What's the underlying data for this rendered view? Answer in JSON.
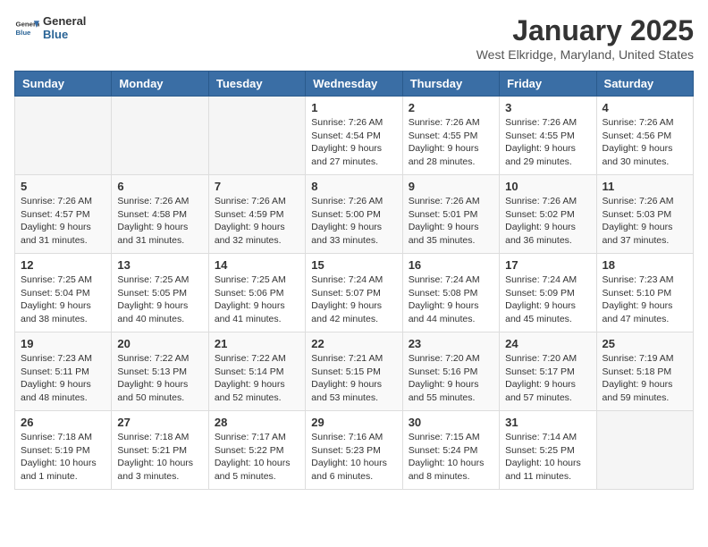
{
  "header": {
    "logo_general": "General",
    "logo_blue": "Blue",
    "month_title": "January 2025",
    "location": "West Elkridge, Maryland, United States"
  },
  "weekdays": [
    "Sunday",
    "Monday",
    "Tuesday",
    "Wednesday",
    "Thursday",
    "Friday",
    "Saturday"
  ],
  "weeks": [
    [
      {
        "day": "",
        "info": ""
      },
      {
        "day": "",
        "info": ""
      },
      {
        "day": "",
        "info": ""
      },
      {
        "day": "1",
        "info": "Sunrise: 7:26 AM\nSunset: 4:54 PM\nDaylight: 9 hours and 27 minutes."
      },
      {
        "day": "2",
        "info": "Sunrise: 7:26 AM\nSunset: 4:55 PM\nDaylight: 9 hours and 28 minutes."
      },
      {
        "day": "3",
        "info": "Sunrise: 7:26 AM\nSunset: 4:55 PM\nDaylight: 9 hours and 29 minutes."
      },
      {
        "day": "4",
        "info": "Sunrise: 7:26 AM\nSunset: 4:56 PM\nDaylight: 9 hours and 30 minutes."
      }
    ],
    [
      {
        "day": "5",
        "info": "Sunrise: 7:26 AM\nSunset: 4:57 PM\nDaylight: 9 hours and 31 minutes."
      },
      {
        "day": "6",
        "info": "Sunrise: 7:26 AM\nSunset: 4:58 PM\nDaylight: 9 hours and 31 minutes."
      },
      {
        "day": "7",
        "info": "Sunrise: 7:26 AM\nSunset: 4:59 PM\nDaylight: 9 hours and 32 minutes."
      },
      {
        "day": "8",
        "info": "Sunrise: 7:26 AM\nSunset: 5:00 PM\nDaylight: 9 hours and 33 minutes."
      },
      {
        "day": "9",
        "info": "Sunrise: 7:26 AM\nSunset: 5:01 PM\nDaylight: 9 hours and 35 minutes."
      },
      {
        "day": "10",
        "info": "Sunrise: 7:26 AM\nSunset: 5:02 PM\nDaylight: 9 hours and 36 minutes."
      },
      {
        "day": "11",
        "info": "Sunrise: 7:26 AM\nSunset: 5:03 PM\nDaylight: 9 hours and 37 minutes."
      }
    ],
    [
      {
        "day": "12",
        "info": "Sunrise: 7:25 AM\nSunset: 5:04 PM\nDaylight: 9 hours and 38 minutes."
      },
      {
        "day": "13",
        "info": "Sunrise: 7:25 AM\nSunset: 5:05 PM\nDaylight: 9 hours and 40 minutes."
      },
      {
        "day": "14",
        "info": "Sunrise: 7:25 AM\nSunset: 5:06 PM\nDaylight: 9 hours and 41 minutes."
      },
      {
        "day": "15",
        "info": "Sunrise: 7:24 AM\nSunset: 5:07 PM\nDaylight: 9 hours and 42 minutes."
      },
      {
        "day": "16",
        "info": "Sunrise: 7:24 AM\nSunset: 5:08 PM\nDaylight: 9 hours and 44 minutes."
      },
      {
        "day": "17",
        "info": "Sunrise: 7:24 AM\nSunset: 5:09 PM\nDaylight: 9 hours and 45 minutes."
      },
      {
        "day": "18",
        "info": "Sunrise: 7:23 AM\nSunset: 5:10 PM\nDaylight: 9 hours and 47 minutes."
      }
    ],
    [
      {
        "day": "19",
        "info": "Sunrise: 7:23 AM\nSunset: 5:11 PM\nDaylight: 9 hours and 48 minutes."
      },
      {
        "day": "20",
        "info": "Sunrise: 7:22 AM\nSunset: 5:13 PM\nDaylight: 9 hours and 50 minutes."
      },
      {
        "day": "21",
        "info": "Sunrise: 7:22 AM\nSunset: 5:14 PM\nDaylight: 9 hours and 52 minutes."
      },
      {
        "day": "22",
        "info": "Sunrise: 7:21 AM\nSunset: 5:15 PM\nDaylight: 9 hours and 53 minutes."
      },
      {
        "day": "23",
        "info": "Sunrise: 7:20 AM\nSunset: 5:16 PM\nDaylight: 9 hours and 55 minutes."
      },
      {
        "day": "24",
        "info": "Sunrise: 7:20 AM\nSunset: 5:17 PM\nDaylight: 9 hours and 57 minutes."
      },
      {
        "day": "25",
        "info": "Sunrise: 7:19 AM\nSunset: 5:18 PM\nDaylight: 9 hours and 59 minutes."
      }
    ],
    [
      {
        "day": "26",
        "info": "Sunrise: 7:18 AM\nSunset: 5:19 PM\nDaylight: 10 hours and 1 minute."
      },
      {
        "day": "27",
        "info": "Sunrise: 7:18 AM\nSunset: 5:21 PM\nDaylight: 10 hours and 3 minutes."
      },
      {
        "day": "28",
        "info": "Sunrise: 7:17 AM\nSunset: 5:22 PM\nDaylight: 10 hours and 5 minutes."
      },
      {
        "day": "29",
        "info": "Sunrise: 7:16 AM\nSunset: 5:23 PM\nDaylight: 10 hours and 6 minutes."
      },
      {
        "day": "30",
        "info": "Sunrise: 7:15 AM\nSunset: 5:24 PM\nDaylight: 10 hours and 8 minutes."
      },
      {
        "day": "31",
        "info": "Sunrise: 7:14 AM\nSunset: 5:25 PM\nDaylight: 10 hours and 11 minutes."
      },
      {
        "day": "",
        "info": ""
      }
    ]
  ]
}
